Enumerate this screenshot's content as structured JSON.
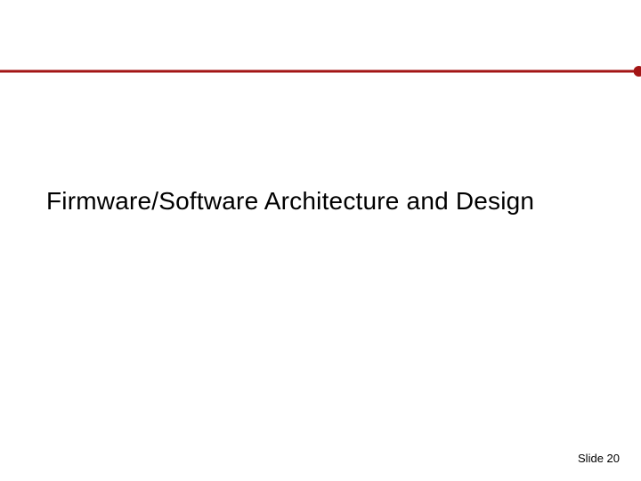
{
  "slide": {
    "title": "Firmware/Software Architecture and Design",
    "footer_label": "Slide 20"
  },
  "colors": {
    "accent": "#a31515"
  }
}
